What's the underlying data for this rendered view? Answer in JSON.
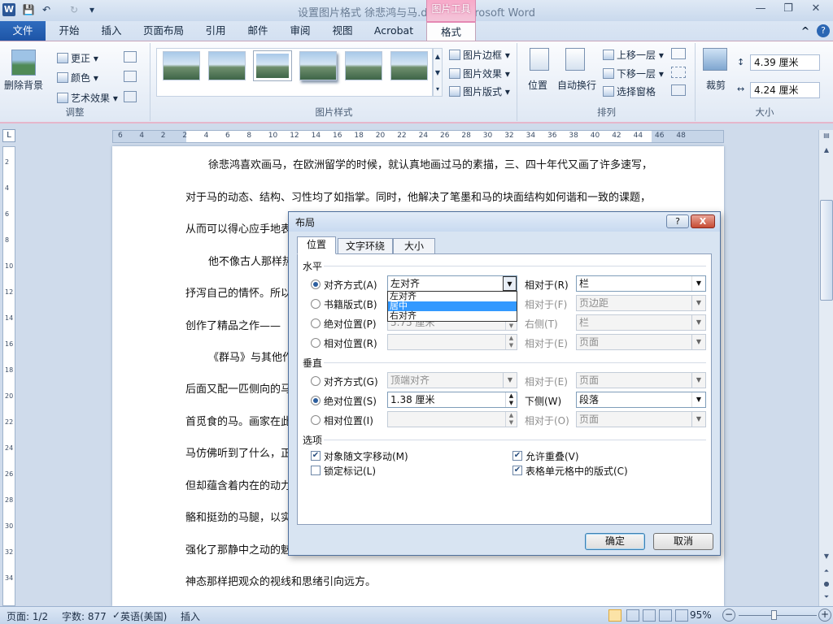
{
  "window": {
    "title": "设置图片格式 徐悲鸿与马.docx - Microsoft Word",
    "context_tab_header": "图片工具",
    "minimize": "—",
    "restore": "❐",
    "close": "✕"
  },
  "quick_access": {
    "undo": "↶",
    "redo": "↻",
    "customize": "▾"
  },
  "tabs": {
    "file": "文件",
    "items": [
      "开始",
      "插入",
      "页面布局",
      "引用",
      "邮件",
      "审阅",
      "视图",
      "Acrobat",
      "格式"
    ],
    "active": "格式",
    "help": "?",
    "collapse": "^"
  },
  "ribbon": {
    "adjust": {
      "remove_bg": "删除背景",
      "corrections": "更正",
      "color": "颜色",
      "artistic": "艺术效果",
      "label": "调整"
    },
    "styles": {
      "border": "图片边框",
      "effects": "图片效果",
      "layout": "图片版式",
      "label": "图片样式"
    },
    "arrange": {
      "position": "位置",
      "wrap": "自动换行",
      "bring_forward": "上移一层",
      "send_backward": "下移一层",
      "selection_pane": "选择窗格",
      "label": "排列"
    },
    "size": {
      "crop": "裁剪",
      "height": "4.39 厘米",
      "width": "4.24 厘米",
      "label": "大小"
    }
  },
  "ruler": {
    "h_ticks": [
      "6",
      "4",
      "2",
      "2",
      "4",
      "6",
      "8",
      "10",
      "12",
      "14",
      "16",
      "18",
      "20",
      "22",
      "24",
      "26",
      "28",
      "30",
      "32",
      "34",
      "36",
      "38",
      "40",
      "42",
      "44",
      "46",
      "48"
    ],
    "v_ticks": [
      "2",
      "4",
      "6",
      "8",
      "10",
      "12",
      "14",
      "16",
      "18",
      "20",
      "22",
      "24",
      "26",
      "28",
      "30",
      "32",
      "34"
    ],
    "tab_selector": "L"
  },
  "document": {
    "lines": [
      "徐悲鸿喜欢画马，在欧洲留学的时候，就认真地画过马的素描，三、四十年代又画了许多速写，",
      "对于马的动态、结构、习性均了如指掌。同时，他解决了笔墨和马的块面结构如何谐和一致的课题，",
      "从而可以得心应手地表",
      "他不像古人那样热",
      "抒泻自己的情怀。所以",
      "创作了精品之作——",
      "《群马》与其他作",
      "后面又配一匹侧向的马",
      "首觅食的马。画家在此",
      "马仿佛听到了什么，正",
      "但却蕴含着内在的动力",
      "骼和挺劲的马腿，以实",
      "强化了那静中之动的魅",
      "神态那样把观众的视线和思绪引向远方。"
    ]
  },
  "dialog": {
    "title": "布局",
    "help": "?",
    "close": "X",
    "tabs": [
      "位置",
      "文字环绕",
      "大小"
    ],
    "horizontal": {
      "section": "水平",
      "align_label": "对齐方式(A)",
      "align_value": "左对齐",
      "align_relative_label": "相对于(R)",
      "align_relative_value": "栏",
      "book_label": "书籍版式(B)",
      "book_relative_label": "相对于(F)",
      "book_relative_value": "页边距",
      "abs_label": "绝对位置(P)",
      "abs_value": "5.75 厘米",
      "abs_right_label": "右侧(T)",
      "abs_right_value": "栏",
      "rel_label": "相对位置(R)",
      "rel_relative_label": "相对于(E)",
      "rel_relative_value": "页面"
    },
    "dropdown_options": [
      "左对齐",
      "居中",
      "右对齐"
    ],
    "dropdown_selected": "居中",
    "vertical": {
      "section": "垂直",
      "align_label": "对齐方式(G)",
      "align_value": "顶端对齐",
      "align_relative_label": "相对于(E)",
      "align_relative_value": "页面",
      "abs_label": "绝对位置(S)",
      "abs_value": "1.38 厘米",
      "below_label": "下侧(W)",
      "below_value": "段落",
      "rel_label": "相对位置(I)",
      "rel_relative_label": "相对于(O)",
      "rel_relative_value": "页面"
    },
    "options": {
      "section": "选项",
      "move_with_text": "对象随文字移动(M)",
      "move_with_text_checked": true,
      "lock_anchor": "锁定标记(L)",
      "lock_anchor_checked": false,
      "allow_overlap": "允许重叠(V)",
      "allow_overlap_checked": true,
      "layout_in_cell": "表格单元格中的版式(C)",
      "layout_in_cell_checked": true
    },
    "ok": "确定",
    "cancel": "取消"
  },
  "status": {
    "page": "页面: 1/2",
    "words": "字数: 877",
    "language": "英语(美国)",
    "mode": "插入",
    "zoom": "95%",
    "zoom_out": "−",
    "zoom_in": "+"
  },
  "colors": {
    "accent": "#2b5797",
    "context": "#e588b3",
    "dialog_bg": "#d8e4f2"
  }
}
